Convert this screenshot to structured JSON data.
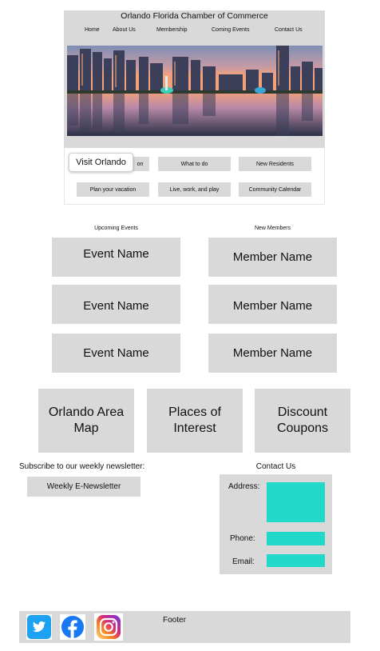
{
  "header": {
    "title": "Orlando Florida Chamber of Commerce",
    "nav": [
      "Home",
      "About Us",
      "Membership",
      "Coming Events",
      "Contact Us"
    ]
  },
  "quick_links": {
    "tooltip": "Visit Orlando",
    "row1_hidden": "on",
    "row1": [
      "What to do",
      "New Residents"
    ],
    "row2": [
      "Plan your vacation",
      "Live, work, and play",
      "Community Calendar"
    ]
  },
  "events": {
    "heading": "Upcoming Events",
    "items": [
      "Event Name",
      "Event Name",
      "Event Name"
    ]
  },
  "members": {
    "heading": "New Members",
    "items": [
      "Member Name",
      "Member Name",
      "Member Name"
    ]
  },
  "features": [
    "Orlando Area Map",
    "Places of Interest",
    "Discount Coupons"
  ],
  "newsletter": {
    "heading": "Subscribe to our weekly newsletter:",
    "button": "Weekly E-Newsletter"
  },
  "contact": {
    "heading": "Contact Us",
    "address_label": "Address:",
    "phone_label": "Phone:",
    "email_label": "Email:"
  },
  "footer": {
    "label": "Footer"
  },
  "colors": {
    "panel_gray": "#d9d9d9",
    "accent_teal": "#22d8c8",
    "twitter": "#1da1f2",
    "facebook": "#1877f2"
  }
}
